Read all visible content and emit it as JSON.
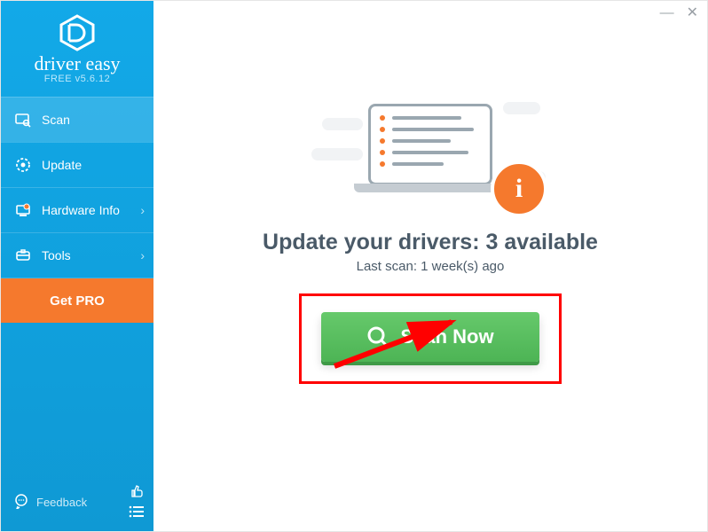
{
  "brand": {
    "name": "driver easy",
    "version_label": "FREE v5.6.12"
  },
  "sidebar": {
    "items": [
      {
        "label": "Scan",
        "icon": "scan-icon",
        "chevron": false,
        "active": true
      },
      {
        "label": "Update",
        "icon": "update-icon",
        "chevron": false,
        "active": false
      },
      {
        "label": "Hardware Info",
        "icon": "hardware-icon",
        "chevron": true,
        "active": false
      },
      {
        "label": "Tools",
        "icon": "tools-icon",
        "chevron": true,
        "active": false
      }
    ],
    "get_pro_label": "Get PRO",
    "feedback_label": "Feedback"
  },
  "main": {
    "headline": "Update your drivers: 3 available",
    "subline": "Last scan: 1 week(s) ago",
    "scan_button_label": "Scan Now"
  }
}
